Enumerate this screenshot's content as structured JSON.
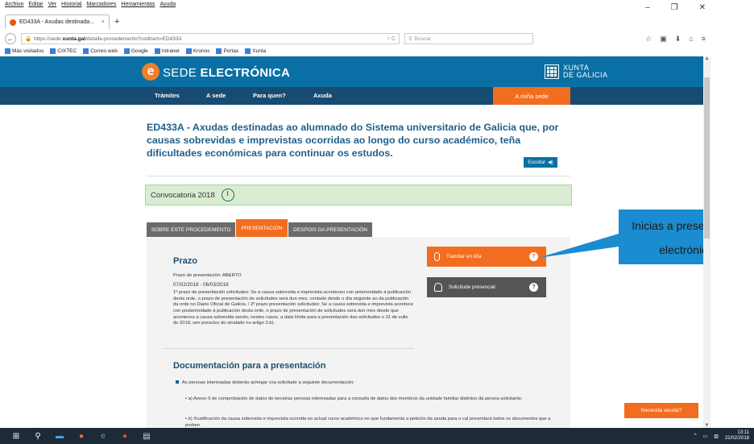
{
  "browser": {
    "menu": [
      "Archivo",
      "Editar",
      "Ver",
      "Historial",
      "Marcadores",
      "Herramientas",
      "Ayuda"
    ],
    "tab_title": "ED433A - Axudas destinada...",
    "url_prefix": "https://sede.",
    "url_domain": "xunta.gal",
    "url_path": "/detalle-procedemento?codtram=ED433A",
    "search_placeholder": "Buscar",
    "bookmarks": [
      "Más visitados",
      "CIXTEC",
      "Correo web",
      "Google",
      "Intranet",
      "Kronos",
      "Portax",
      "Xunta"
    ]
  },
  "site": {
    "brand_plain": "SEDE ",
    "brand_bold": "ELECTRÓNICA",
    "logo_letter": "e",
    "xunta_line1": "XUNTA",
    "xunta_line2": "DE GALICIA",
    "nav": [
      "Trámites",
      "A sede",
      "Para quen?",
      "Axuda"
    ],
    "my_sede": "A miña sede",
    "accent": "#f26d1f",
    "header_color": "#0a6fa4",
    "nav_color": "#184b72"
  },
  "content": {
    "title": "ED433A - Axudas destinadas ao alumnado do Sistema universitario de Galicia que, por causas sobrevidas e imprevistas ocorridas ao longo do curso académico, teña dificultades económicas para continuar os estudos.",
    "listen": "Escoitar",
    "convocatoria": "Convocatoria 2018",
    "tabs": [
      "SOBRE ESTE PROCEDEMENTO",
      "PRESENTACIÓN",
      "DESPOIS DA PRESENTACIÓN"
    ],
    "prazo_heading": "Prazo",
    "prazo_status": "Prazo de presentación: ABERTO",
    "prazo_dates": "07/02/2018 - 06/03/2018",
    "prazo_text": "1º prazo de presentación solicitudes: Se a causa sobrevida e imprevista aconteceu con anterioridade á publicación desta orde, o prazo de presentación de solicitudes será dun mes, contado desde o día seguinte ao da publicación da orde no Diario Oficial de Galicia. / 2º prazo presentación solicitudes: Se a causa sobrevida e imprevista acontece con posterioridade á publicación desta orde, o prazo de presentación de solicitudes será dun mes desde que aconteceu a causa sobrevida sendo, nestes casos, a data límite para a presentación das solicitudes o 31 de xullo de 2018, sen prexuízo do sinalado no artigo 3.b).",
    "doc_heading": "Documentación para a presentación",
    "doc_intro": "As persoas interesadas deberán achegar coa solicitude a seguinte documentación:",
    "doc_a": "a) Anexo II de comprobación de datos de terceiras persoas interesadas para a consulta de datos dos membros da unidade familiar distintos da persoa solicitante.",
    "doc_b": "b) Xustificación da causa sobrevida e imprevista ocorrida no actual curso académico en que fundamenta a petición da axuda para o cal presentará todos os documentos que a proben.",
    "tramitar": "Tramitar en liña",
    "presencial": "Solicitude presencial",
    "qmark": "?",
    "help": "Necesita axuda?"
  },
  "callout": {
    "line1": "Inicias a presentación",
    "line2": "electrónica"
  },
  "taskbar": {
    "time": "13:11",
    "date": "21/02/2018"
  }
}
